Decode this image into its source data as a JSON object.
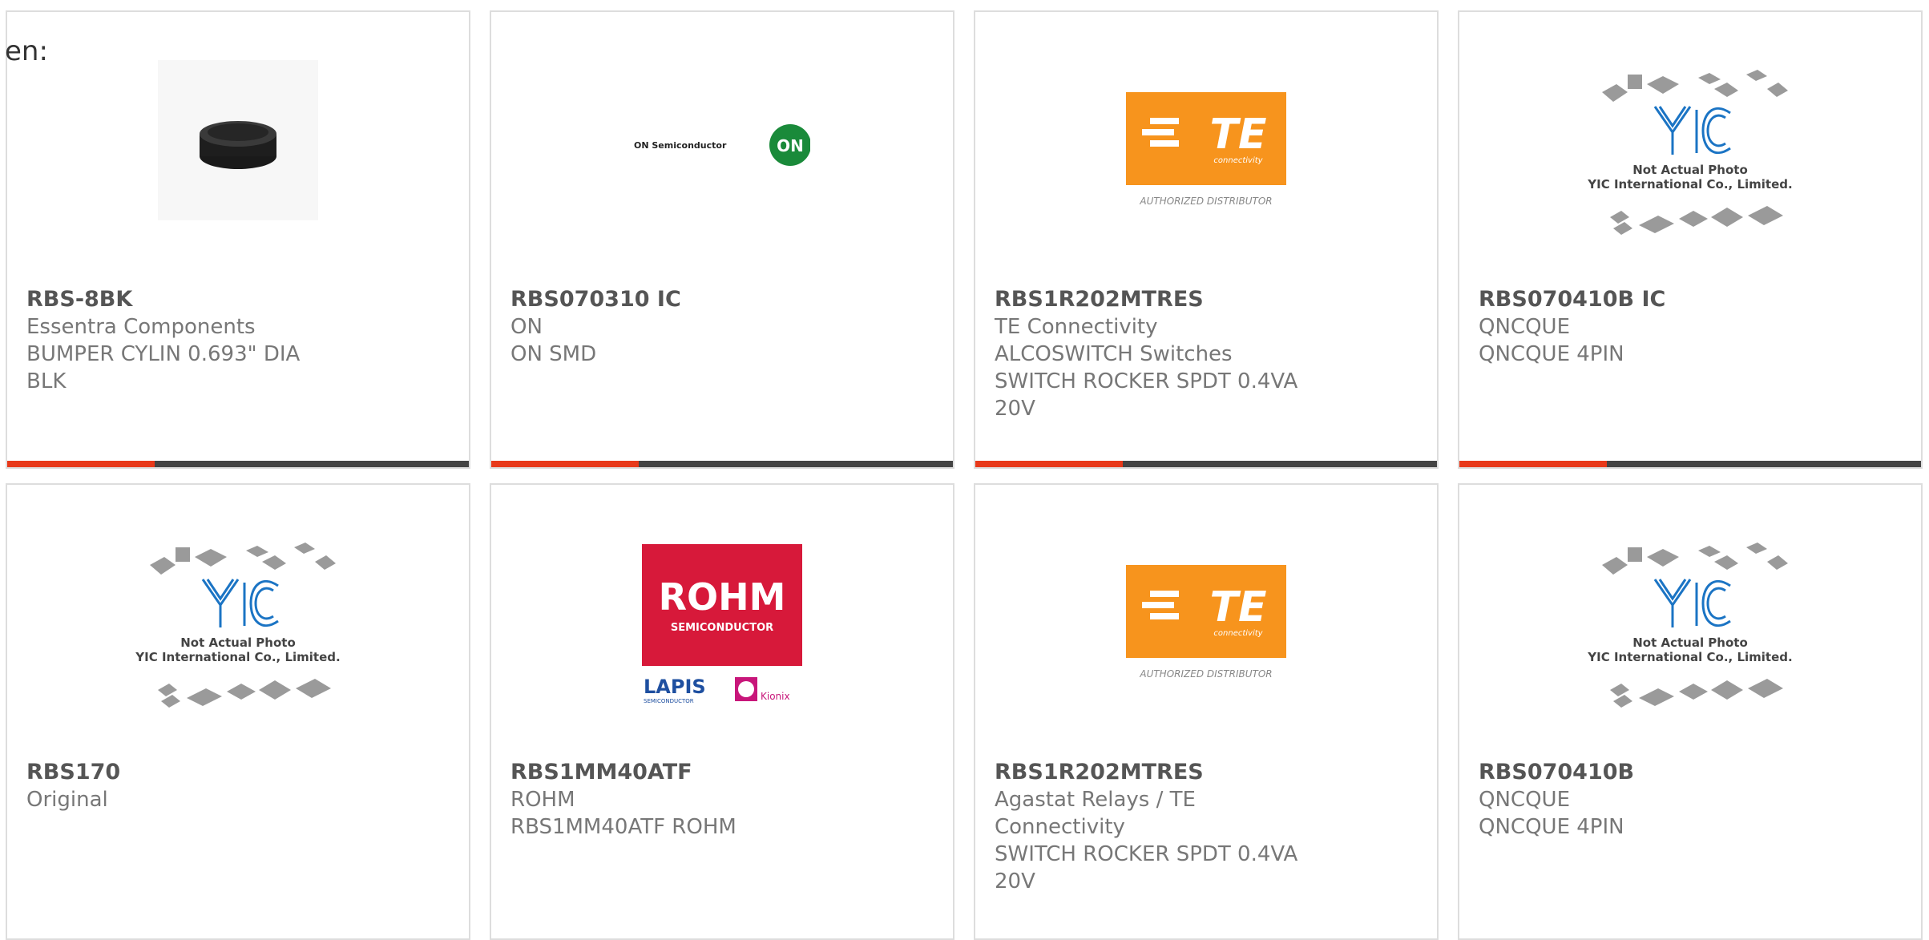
{
  "page": {
    "label": "en:"
  },
  "cards": [
    {
      "part": "RBS-8BK",
      "lines": [
        "Essentra Components",
        "BUMPER CYLIN 0.693\" DIA BLK"
      ],
      "image": "black-rubber-bumper-photo"
    },
    {
      "part": "RBS070310 IC",
      "lines": [
        "ON",
        "ON SMD"
      ],
      "image": "on-semiconductor-logo",
      "logo_text": "ON Semiconductor",
      "logo_badge": "ON"
    },
    {
      "part": "RBS1R202MTRES",
      "lines": [
        "TE Connectivity ALCOSWITCH Switches",
        "SWITCH ROCKER SPDT 0.4VA 20V"
      ],
      "image": "te-connectivity-logo",
      "logo_text": "connectivity",
      "logo_caption": "AUTHORIZED DISTRIBUTOR"
    },
    {
      "part": "RBS070410B IC",
      "lines": [
        "QNCQUE",
        "QNCQUE 4PIN"
      ],
      "image": "yic-placeholder",
      "placeholder": [
        "Not Actual Photo",
        "YIC International Co., Limited."
      ]
    },
    {
      "part": "RBS170",
      "lines": [
        "Original"
      ],
      "image": "yic-placeholder",
      "placeholder": [
        "Not Actual Photo",
        "YIC International Co., Limited."
      ]
    },
    {
      "part": "RBS1MM40ATF",
      "lines": [
        "ROHM",
        "RBS1MM40ATF ROHM"
      ],
      "image": "rohm-logo",
      "logo_text": "ROHM",
      "logo_sub": "SEMICONDUCTOR",
      "logo_lapis": "LAPIS",
      "logo_lapis_sub": "SEMICONDUCTOR",
      "logo_kionix": "Kionix"
    },
    {
      "part": "RBS1R202MTRES",
      "lines": [
        "Agastat Relays / TE Connectivity",
        "SWITCH ROCKER SPDT 0.4VA 20V"
      ],
      "image": "te-connectivity-logo",
      "logo_text": "connectivity",
      "logo_caption": "AUTHORIZED DISTRIBUTOR"
    },
    {
      "part": "RBS070410B",
      "lines": [
        "QNCQUE",
        "QNCQUE 4PIN"
      ],
      "image": "yic-placeholder",
      "placeholder": [
        "Not Actual Photo",
        "YIC International Co., Limited."
      ]
    }
  ],
  "colors": {
    "accent": "#e8391a",
    "bar": "#444444",
    "te_orange": "#f7941d",
    "rohm_red": "#d7193a",
    "yic_blue": "#1b74c4",
    "on_green": "#1a8a3a"
  }
}
